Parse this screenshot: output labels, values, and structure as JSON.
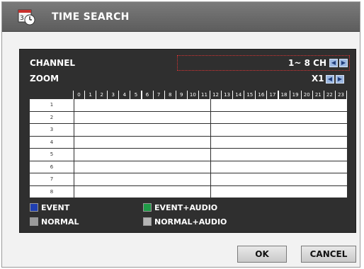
{
  "window": {
    "title": "TIME SEARCH",
    "icon": "calendar-clock-icon"
  },
  "channel": {
    "label": "CHANNEL",
    "value": "1~ 8 CH"
  },
  "zoom": {
    "label": "ZOOM",
    "value": "X1"
  },
  "grid": {
    "hours": [
      "0",
      "1",
      "2",
      "3",
      "4",
      "5",
      "6",
      "7",
      "8",
      "9",
      "10",
      "11",
      "12",
      "13",
      "14",
      "15",
      "16",
      "17",
      "18",
      "19",
      "20",
      "21",
      "22",
      "23"
    ],
    "rows": [
      "1",
      "2",
      "3",
      "4",
      "5",
      "6",
      "7",
      "8"
    ]
  },
  "legend": [
    {
      "label": "EVENT",
      "color": "#1f3fb0"
    },
    {
      "label": "EVENT+AUDIO",
      "color": "#1f9b47"
    },
    {
      "label": "NORMAL",
      "color": "#9a9a9a"
    },
    {
      "label": "NORMAL+AUDIO",
      "color": "#b5b5b5"
    }
  ],
  "buttons": {
    "ok": "OK",
    "cancel": "CANCEL"
  }
}
